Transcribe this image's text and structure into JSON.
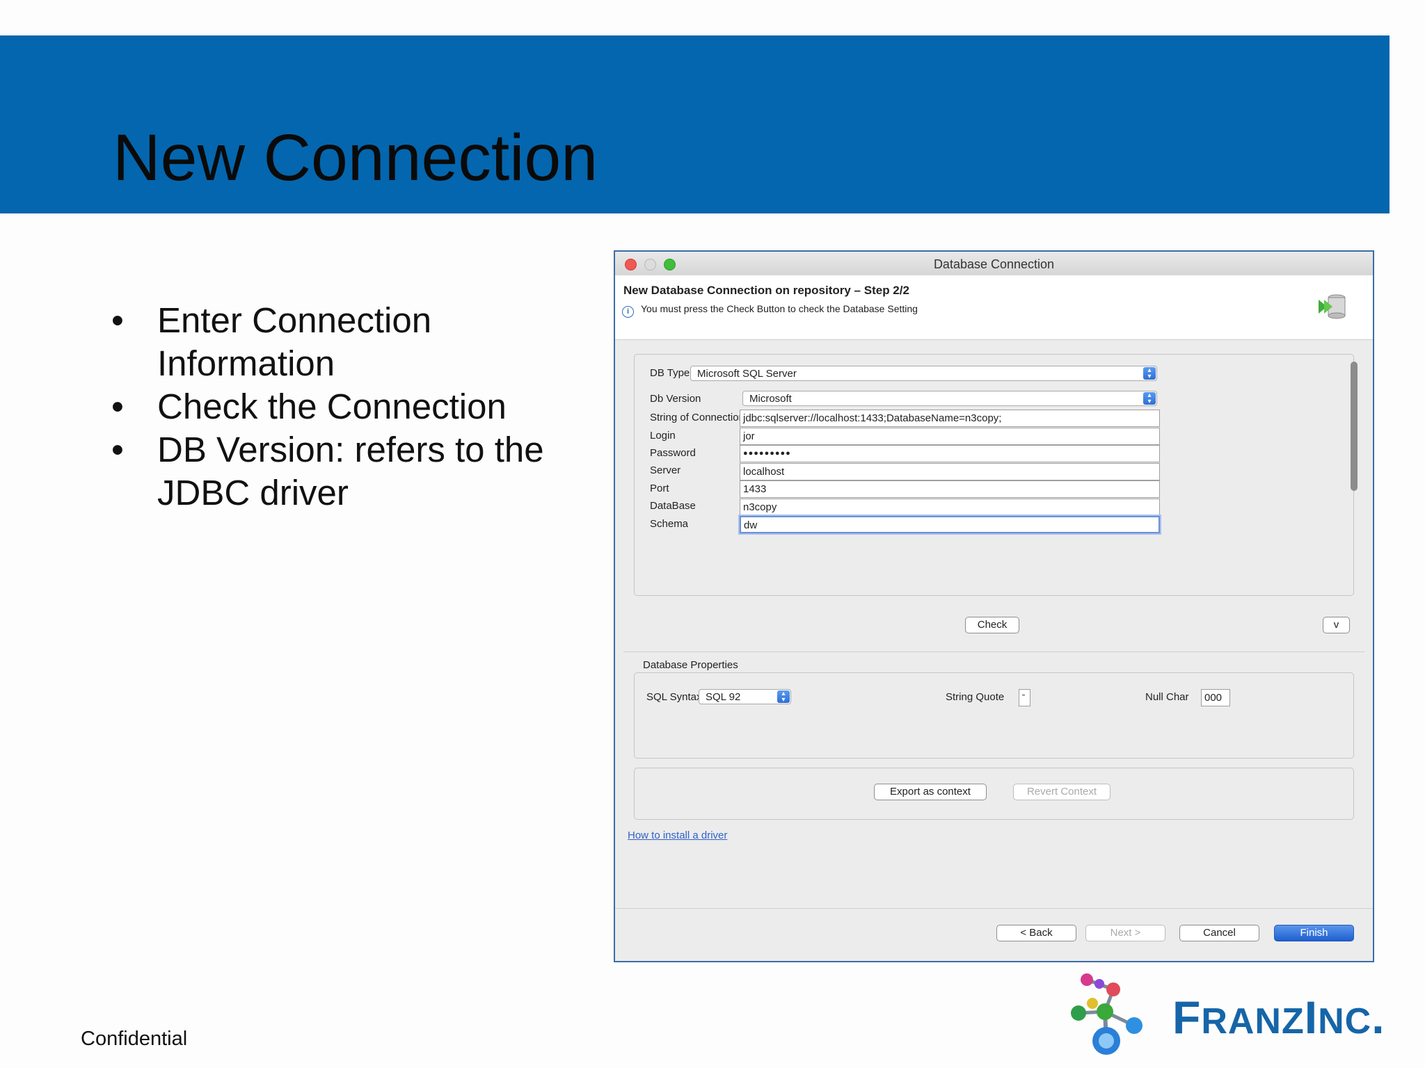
{
  "slide": {
    "title": "New Connection",
    "bullets": [
      "Enter Connection Information",
      "Check the Connection",
      "DB Version: refers to the JDBC driver"
    ],
    "footer": "Confidential",
    "logo_text_big1": "F",
    "logo_text_small1": "RANZ",
    "logo_text_big2": "I",
    "logo_text_small2": "NC",
    "logo_text_dot": "."
  },
  "dialog": {
    "window_title": "Database Connection",
    "wizard_title": "New Database Connection on repository – Step 2/2",
    "info_message": "You must press the Check Button to check the Database Setting",
    "fields": {
      "db_type_label": "DB Type",
      "db_type_value": "Microsoft SQL Server",
      "db_version_label": "Db Version",
      "db_version_value": "Microsoft",
      "conn_label": "String of Connection",
      "conn_value": "jdbc:sqlserver://localhost:1433;DatabaseName=n3copy;",
      "login_label": "Login",
      "login_value": "jor",
      "password_label": "Password",
      "password_value": "●●●●●●●●●",
      "server_label": "Server",
      "server_value": "localhost",
      "port_label": "Port",
      "port_value": "1433",
      "database_label": "DataBase",
      "database_value": "n3copy",
      "schema_label": "Schema",
      "schema_value": "dw"
    },
    "check_label": "Check",
    "v_label": "v",
    "properties": {
      "section_title": "Database Properties",
      "sql_syntax_label": "SQL Syntax",
      "sql_syntax_value": "SQL 92",
      "string_quote_label": "String Quote",
      "string_quote_value": "\"",
      "null_char_label": "Null Char",
      "null_char_value": "000"
    },
    "export_label": "Export as context",
    "revert_label": "Revert Context",
    "install_link": "How to install a driver",
    "buttons": {
      "back": "< Back",
      "next": "Next >",
      "cancel": "Cancel",
      "finish": "Finish"
    }
  },
  "colors": {
    "banner": "#0466ae",
    "logo": "#1565a8",
    "primary_button": "#2d6fd6"
  }
}
